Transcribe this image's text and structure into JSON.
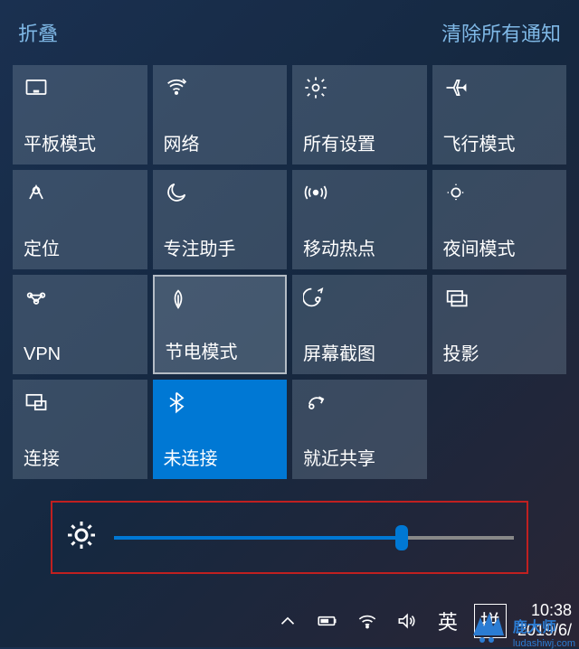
{
  "header": {
    "collapse": "折叠",
    "clear_all": "清除所有通知"
  },
  "tiles": [
    {
      "id": "tablet-mode",
      "label": "平板模式",
      "icon": "tablet"
    },
    {
      "id": "network",
      "label": "网络",
      "icon": "wifi-bars"
    },
    {
      "id": "all-settings",
      "label": "所有设置",
      "icon": "gear"
    },
    {
      "id": "airplane-mode",
      "label": "飞行模式",
      "icon": "airplane"
    },
    {
      "id": "location",
      "label": "定位",
      "icon": "location"
    },
    {
      "id": "focus-assist",
      "label": "专注助手",
      "icon": "moon"
    },
    {
      "id": "mobile-hotspot",
      "label": "移动热点",
      "icon": "hotspot"
    },
    {
      "id": "night-light",
      "label": "夜间模式",
      "icon": "night-light"
    },
    {
      "id": "vpn",
      "label": "VPN",
      "icon": "vpn"
    },
    {
      "id": "battery-saver",
      "label": "节电模式",
      "icon": "leaf"
    },
    {
      "id": "screen-snip",
      "label": "屏幕截图",
      "icon": "snip"
    },
    {
      "id": "project",
      "label": "投影",
      "icon": "project"
    },
    {
      "id": "connect",
      "label": "连接",
      "icon": "connect"
    },
    {
      "id": "bluetooth",
      "label": "未连接",
      "icon": "bluetooth"
    },
    {
      "id": "nearby-sharing",
      "label": "就近共享",
      "icon": "share"
    }
  ],
  "brightness": {
    "value_percent": 72
  },
  "taskbar": {
    "ime_lang": "英",
    "ime_mode": "拼",
    "time": "10:38",
    "date": "2019/6/"
  },
  "watermark": {
    "brand": "鹿大师",
    "url": "ludashiwj.com"
  },
  "colors": {
    "accent_active": "#0078d4",
    "highlight_box": "#c02020",
    "link": "#7fb8e6"
  }
}
